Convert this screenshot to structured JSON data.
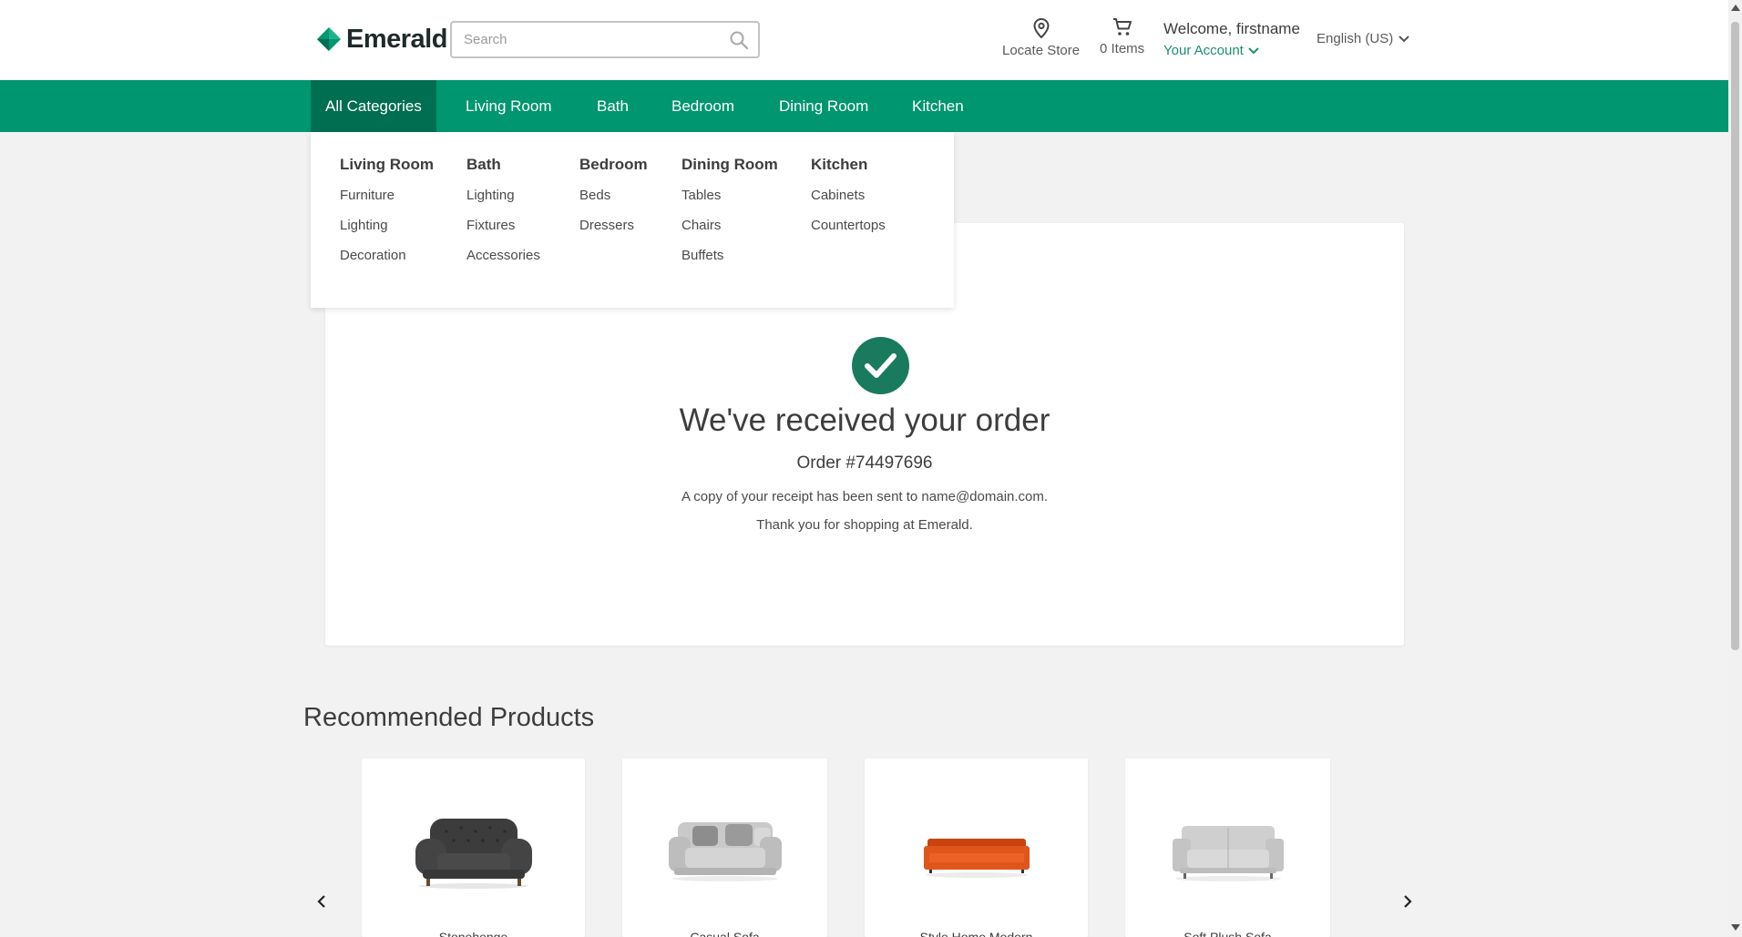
{
  "header": {
    "brand": "Emerald",
    "search_placeholder": "Search",
    "locate_store": "Locate Store",
    "cart_items": "0 Items",
    "welcome": "Welcome, firstname",
    "account": "Your Account",
    "language": "English (US)"
  },
  "nav": {
    "items": [
      "All Categories",
      "Living Room",
      "Bath",
      "Bedroom",
      "Dining Room",
      "Kitchen"
    ],
    "active": "All Categories"
  },
  "mega_menu": {
    "columns": [
      {
        "heading": "Living Room",
        "links": [
          "Furniture",
          "Lighting",
          "Decoration"
        ]
      },
      {
        "heading": "Bath",
        "links": [
          "Lighting",
          "Fixtures",
          "Accessories"
        ]
      },
      {
        "heading": "Bedroom",
        "links": [
          "Beds",
          "Dressers"
        ]
      },
      {
        "heading": "Dining Room",
        "links": [
          "Tables",
          "Chairs",
          "Buffets"
        ]
      },
      {
        "heading": "Kitchen",
        "links": [
          "Cabinets",
          "Countertops"
        ]
      }
    ]
  },
  "confirmation": {
    "title": "We've received your order",
    "order": "Order #74497696",
    "receipt_note": "A copy of your receipt has been sent to name@domain.com.",
    "thanks": "Thank you for shopping at Emerald."
  },
  "recommended": {
    "title": "Recommended Products",
    "products": [
      {
        "name": "Stonehenge",
        "icon": "dark-chesterfield-chair-image"
      },
      {
        "name": "Casual Sofa",
        "icon": "grey-sofa-image"
      },
      {
        "name": "Style Home Modern",
        "icon": "orange-sofa-image"
      },
      {
        "name": "Soft Plush Sofa",
        "icon": "light-grey-sofa-image"
      }
    ]
  },
  "colors": {
    "brand_green": "#00966f",
    "active_nav": "#006e50",
    "check_green": "#1a7a5e",
    "account_link": "#1a8f6e"
  }
}
